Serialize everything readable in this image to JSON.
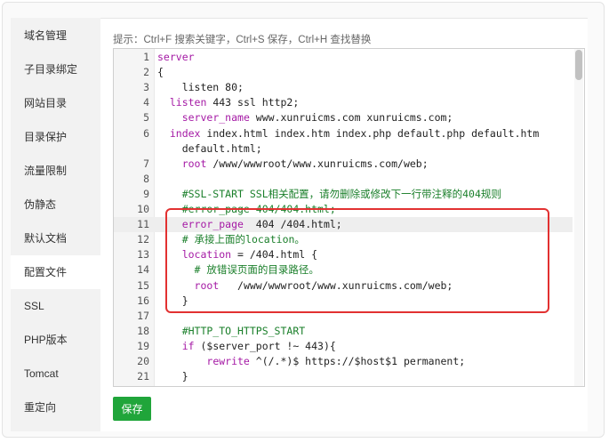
{
  "sidebar": {
    "items": [
      {
        "label": "域名管理",
        "active": false
      },
      {
        "label": "子目录绑定",
        "active": false
      },
      {
        "label": "网站目录",
        "active": false
      },
      {
        "label": "目录保护",
        "active": false
      },
      {
        "label": "流量限制",
        "active": false
      },
      {
        "label": "伪静态",
        "active": false
      },
      {
        "label": "默认文档",
        "active": false
      },
      {
        "label": "配置文件",
        "active": true
      },
      {
        "label": "SSL",
        "active": false
      },
      {
        "label": "PHP版本",
        "active": false
      },
      {
        "label": "Tomcat",
        "active": false
      },
      {
        "label": "重定向",
        "active": false
      }
    ]
  },
  "main": {
    "hint": "提示：Ctrl+F 搜索关键字，Ctrl+S 保存，Ctrl+H 查找替换",
    "save_label": "保存"
  },
  "editor": {
    "highlighted_line": 11,
    "lines": [
      {
        "n": "1",
        "segments": [
          {
            "t": "server",
            "c": "kw"
          }
        ]
      },
      {
        "n": "2",
        "segments": [
          {
            "t": "{",
            "c": ""
          }
        ]
      },
      {
        "n": "3",
        "segments": [
          {
            "t": "    listen 80;",
            "c": ""
          }
        ]
      },
      {
        "n": "4",
        "segments": [
          {
            "t": "  ",
            "c": ""
          },
          {
            "t": "listen",
            "c": "kw"
          },
          {
            "t": " 443 ssl http2;",
            "c": ""
          }
        ]
      },
      {
        "n": "5",
        "segments": [
          {
            "t": "    ",
            "c": ""
          },
          {
            "t": "server_name",
            "c": "kw"
          },
          {
            "t": " www.xunruicms.com xunruicms.com;",
            "c": ""
          }
        ]
      },
      {
        "n": "6",
        "segments": [
          {
            "t": "  ",
            "c": ""
          },
          {
            "t": "index",
            "c": "kw"
          },
          {
            "t": " index.html index.htm index.php default.php default.htm",
            "c": ""
          }
        ]
      },
      {
        "n": "",
        "segments": [
          {
            "t": "    default.html;",
            "c": ""
          }
        ]
      },
      {
        "n": "7",
        "segments": [
          {
            "t": "    ",
            "c": ""
          },
          {
            "t": "root",
            "c": "kw"
          },
          {
            "t": " /www/wwwroot/www.xunruicms.com/web;",
            "c": ""
          }
        ]
      },
      {
        "n": "8",
        "segments": [
          {
            "t": "",
            "c": ""
          }
        ]
      },
      {
        "n": "9",
        "segments": [
          {
            "t": "    #SSL-START SSL相关配置，请勿删除或修改下一行带注释的404规则",
            "c": "cm"
          }
        ]
      },
      {
        "n": "10",
        "segments": [
          {
            "t": "    #error_page 404/404.html;",
            "c": "cm"
          }
        ]
      },
      {
        "n": "11",
        "segments": [
          {
            "t": "    ",
            "c": ""
          },
          {
            "t": "error_page",
            "c": "kw"
          },
          {
            "t": "  404 /404.html;",
            "c": ""
          }
        ]
      },
      {
        "n": "12",
        "segments": [
          {
            "t": "    # 承接上面的location。",
            "c": "cm"
          }
        ]
      },
      {
        "n": "13",
        "segments": [
          {
            "t": "    ",
            "c": ""
          },
          {
            "t": "location",
            "c": "kw"
          },
          {
            "t": " = /404.html {",
            "c": ""
          }
        ]
      },
      {
        "n": "14",
        "segments": [
          {
            "t": "      # 放错误页面的目录路径。",
            "c": "cm"
          }
        ]
      },
      {
        "n": "15",
        "segments": [
          {
            "t": "      ",
            "c": ""
          },
          {
            "t": "root",
            "c": "kw"
          },
          {
            "t": "   /www/wwwroot/www.xunruicms.com/web;",
            "c": ""
          }
        ]
      },
      {
        "n": "16",
        "segments": [
          {
            "t": "    }",
            "c": ""
          }
        ]
      },
      {
        "n": "17",
        "segments": [
          {
            "t": "",
            "c": ""
          }
        ]
      },
      {
        "n": "18",
        "segments": [
          {
            "t": "    #HTTP_TO_HTTPS_START",
            "c": "cm"
          }
        ]
      },
      {
        "n": "19",
        "segments": [
          {
            "t": "    ",
            "c": ""
          },
          {
            "t": "if",
            "c": "kw"
          },
          {
            "t": " ($server_port !~ 443){",
            "c": ""
          }
        ]
      },
      {
        "n": "20",
        "segments": [
          {
            "t": "        ",
            "c": ""
          },
          {
            "t": "rewrite",
            "c": "kw"
          },
          {
            "t": " ^(/.*)$ https://$host$1 permanent;",
            "c": ""
          }
        ]
      },
      {
        "n": "21",
        "segments": [
          {
            "t": "    }",
            "c": ""
          }
        ]
      }
    ]
  },
  "colors": {
    "accent": "#20a53a",
    "highlight_box": "#e23131",
    "keyword": "#a51aa5",
    "comment": "#1a7f2a"
  }
}
